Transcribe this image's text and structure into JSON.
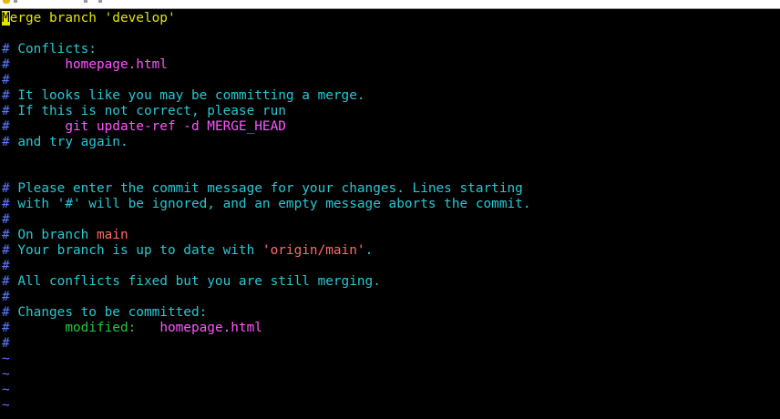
{
  "terminal": {
    "lines": [
      {
        "kind": "subject",
        "cursor": "M",
        "text": "erge branch 'develop'"
      },
      {
        "kind": "blank"
      },
      {
        "kind": "comment",
        "hash": "#",
        "text": " Conflicts:"
      },
      {
        "kind": "comment-indent",
        "hash": "#",
        "indent": "       ",
        "value": "homepage.html"
      },
      {
        "kind": "hash-only",
        "hash": "#"
      },
      {
        "kind": "comment",
        "hash": "#",
        "text": " It looks like you may be committing a merge."
      },
      {
        "kind": "comment",
        "hash": "#",
        "text": " If this is not correct, please run"
      },
      {
        "kind": "comment-indent",
        "hash": "#",
        "indent": "       ",
        "value": "git update-ref -d MERGE_HEAD"
      },
      {
        "kind": "comment",
        "hash": "#",
        "text": " and try again."
      },
      {
        "kind": "blank"
      },
      {
        "kind": "blank"
      },
      {
        "kind": "comment",
        "hash": "#",
        "text": " Please enter the commit message for your changes. Lines starting"
      },
      {
        "kind": "comment",
        "hash": "#",
        "text": " with '#' will be ignored, and an empty message aborts the commit."
      },
      {
        "kind": "hash-only",
        "hash": "#"
      },
      {
        "kind": "branch",
        "hash": "#",
        "prefix": " On branch ",
        "branch": "main"
      },
      {
        "kind": "upstream",
        "hash": "#",
        "prefix": " Your branch is up to date with ",
        "remote": "'origin/main'",
        "suffix": "."
      },
      {
        "kind": "hash-only",
        "hash": "#"
      },
      {
        "kind": "comment",
        "hash": "#",
        "text": " All conflicts fixed but you are still merging."
      },
      {
        "kind": "hash-only",
        "hash": "#"
      },
      {
        "kind": "comment",
        "hash": "#",
        "text": " Changes to be committed:"
      },
      {
        "kind": "modified",
        "hash": "#",
        "indent": "       ",
        "status": "modified:",
        "gap": "   ",
        "file": "homepage.html"
      },
      {
        "kind": "hash-only",
        "hash": "#"
      },
      {
        "kind": "tilde",
        "text": "~"
      },
      {
        "kind": "tilde",
        "text": "~"
      },
      {
        "kind": "tilde",
        "text": "~"
      },
      {
        "kind": "tilde",
        "text": "~"
      }
    ]
  },
  "colors": {
    "background": "#000000",
    "subject": "#e5e500",
    "hash": "#5c78ff",
    "comment": "#27c8d4",
    "path": "#ff55ff",
    "branch": "#ff6b6b",
    "modified": "#23c83a",
    "tilde": "#5c78ff"
  }
}
